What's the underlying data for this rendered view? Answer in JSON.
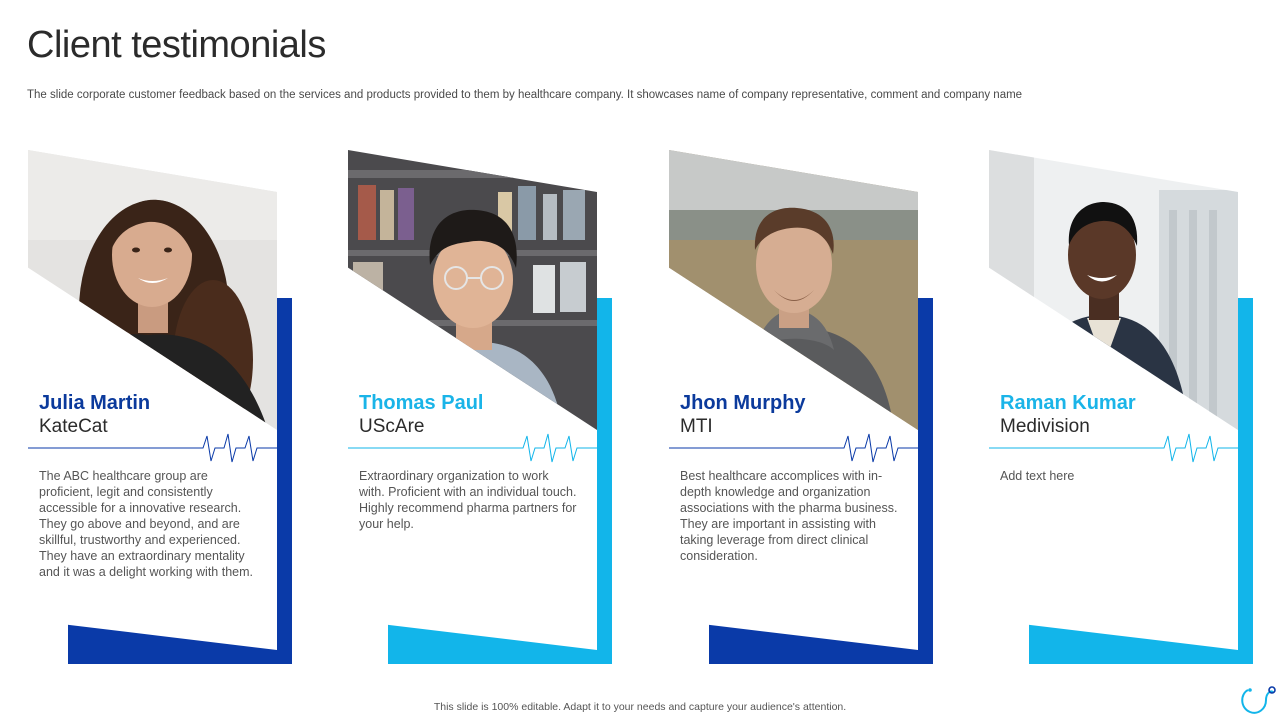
{
  "slide": {
    "title": "Client testimonials",
    "subtitle": "The slide corporate customer feedback based on the services and products provided to them by healthcare company. It showcases name of company representative, comment and company name",
    "footer": "This slide is 100% editable. Adapt it to your needs and capture your audience's attention.",
    "logo_icon": "stethoscope-icon"
  },
  "colors": {
    "dark_blue": "#0a3aa8",
    "light_blue": "#12b5ea",
    "dark_name": "#0b3a9c",
    "light_name": "#1ab4e8"
  },
  "cards": [
    {
      "name": "Julia Martin",
      "company": "KateCat",
      "comment": "The ABC healthcare group are proficient, legit and consistently accessible for a innovative research. They go above and beyond, and are skillful, trustworthy and experienced. They have an extraordinary mentality and it was a delight working with them.",
      "photo_icon": "woman-portrait-icon"
    },
    {
      "name": "Thomas Paul",
      "company": "UScAre",
      "comment": "Extraordinary organization to work with. Proficient with an individual touch. Highly recommend pharma partners for your help.",
      "photo_icon": "man-glasses-portrait-icon"
    },
    {
      "name": "Jhon Murphy",
      "company": "MTI",
      "comment": "Best healthcare accomplices with in-depth knowledge and organization associations with the pharma business. They are important in assisting with taking leverage from direct clinical consideration.",
      "photo_icon": "man-hoodie-portrait-icon"
    },
    {
      "name": "Raman Kumar",
      "company": "Medivision",
      "comment": "Add text here",
      "photo_icon": "man-sweater-portrait-icon"
    }
  ]
}
